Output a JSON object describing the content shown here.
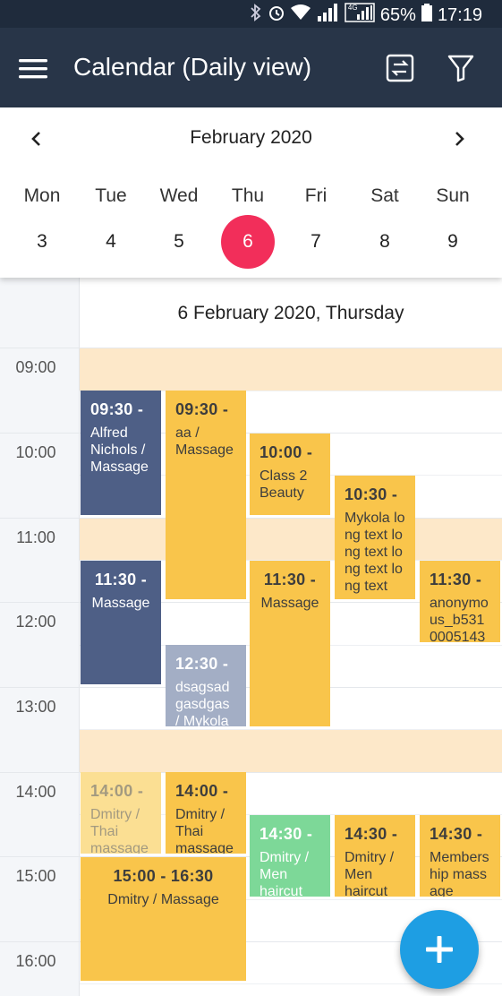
{
  "status_bar": {
    "battery": "65%",
    "time": "17:19",
    "net": "4G"
  },
  "app_bar": {
    "title": "Calendar (Daily view)"
  },
  "week": {
    "month_label": "February 2020",
    "days": [
      {
        "name": "Mon",
        "num": "3"
      },
      {
        "name": "Tue",
        "num": "4"
      },
      {
        "name": "Wed",
        "num": "5"
      },
      {
        "name": "Thu",
        "num": "6"
      },
      {
        "name": "Fri",
        "num": "7"
      },
      {
        "name": "Sat",
        "num": "8"
      },
      {
        "name": "Sun",
        "num": "9"
      }
    ],
    "selected_day": "6"
  },
  "day_header": "6 February 2020, Thursday",
  "hours": [
    "09:00",
    "10:00",
    "11:00",
    "12:00",
    "13:00",
    "14:00",
    "15:00",
    "16:00"
  ],
  "events": [
    {
      "time": "09:30 -",
      "desc": "Alfred Nichols / Massage"
    },
    {
      "time": "09:30 -",
      "desc": "aa / Massage"
    },
    {
      "time": "10:00 -",
      "desc": "Class 2 Beauty"
    },
    {
      "time": "10:30 -",
      "desc": "Mykola long text long text long text long text"
    },
    {
      "time": "11:30 -",
      "desc": "Massage"
    },
    {
      "time": "11:30 -",
      "desc": "Massage"
    },
    {
      "time": "11:30 -",
      "desc": "anonymous_b531 0005143"
    },
    {
      "time": "12:30 -",
      "desc": "dsagsad gasdgas / Mykola"
    },
    {
      "time": "14:00 -",
      "desc": "Dmitry / Thai massage"
    },
    {
      "time": "14:00 -",
      "desc": "Dmitry / Thai massage"
    },
    {
      "time": "14:30 -",
      "desc": "Dmitry / Men haircut"
    },
    {
      "time": "14:30 -",
      "desc": "Dmitry / Men haircut"
    },
    {
      "time": "14:30 -",
      "desc": "Membership massage"
    },
    {
      "time": "15:00 - 16:30",
      "desc": "Dmitry / Massage"
    }
  ],
  "colors": {
    "header": "#283548",
    "selected": "#f22e5a",
    "fab": "#1e9ee3",
    "navy_event": "#4e5f86",
    "yellow_event": "#f9c54b",
    "band": "#fde8c9"
  },
  "icons": [
    "menu-icon",
    "swap-icon",
    "filter-icon",
    "chevron-left-icon",
    "chevron-right-icon",
    "add-icon"
  ]
}
